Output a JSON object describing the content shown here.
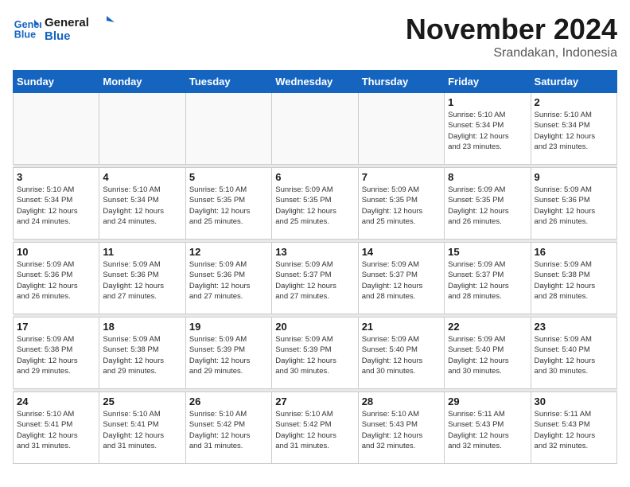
{
  "logo": {
    "line1": "General",
    "line2": "Blue"
  },
  "title": "November 2024",
  "location": "Srandakan, Indonesia",
  "weekdays": [
    "Sunday",
    "Monday",
    "Tuesday",
    "Wednesday",
    "Thursday",
    "Friday",
    "Saturday"
  ],
  "weeks": [
    [
      {
        "day": "",
        "info": ""
      },
      {
        "day": "",
        "info": ""
      },
      {
        "day": "",
        "info": ""
      },
      {
        "day": "",
        "info": ""
      },
      {
        "day": "",
        "info": ""
      },
      {
        "day": "1",
        "info": "Sunrise: 5:10 AM\nSunset: 5:34 PM\nDaylight: 12 hours\nand 23 minutes."
      },
      {
        "day": "2",
        "info": "Sunrise: 5:10 AM\nSunset: 5:34 PM\nDaylight: 12 hours\nand 23 minutes."
      }
    ],
    [
      {
        "day": "3",
        "info": "Sunrise: 5:10 AM\nSunset: 5:34 PM\nDaylight: 12 hours\nand 24 minutes."
      },
      {
        "day": "4",
        "info": "Sunrise: 5:10 AM\nSunset: 5:34 PM\nDaylight: 12 hours\nand 24 minutes."
      },
      {
        "day": "5",
        "info": "Sunrise: 5:10 AM\nSunset: 5:35 PM\nDaylight: 12 hours\nand 25 minutes."
      },
      {
        "day": "6",
        "info": "Sunrise: 5:09 AM\nSunset: 5:35 PM\nDaylight: 12 hours\nand 25 minutes."
      },
      {
        "day": "7",
        "info": "Sunrise: 5:09 AM\nSunset: 5:35 PM\nDaylight: 12 hours\nand 25 minutes."
      },
      {
        "day": "8",
        "info": "Sunrise: 5:09 AM\nSunset: 5:35 PM\nDaylight: 12 hours\nand 26 minutes."
      },
      {
        "day": "9",
        "info": "Sunrise: 5:09 AM\nSunset: 5:36 PM\nDaylight: 12 hours\nand 26 minutes."
      }
    ],
    [
      {
        "day": "10",
        "info": "Sunrise: 5:09 AM\nSunset: 5:36 PM\nDaylight: 12 hours\nand 26 minutes."
      },
      {
        "day": "11",
        "info": "Sunrise: 5:09 AM\nSunset: 5:36 PM\nDaylight: 12 hours\nand 27 minutes."
      },
      {
        "day": "12",
        "info": "Sunrise: 5:09 AM\nSunset: 5:36 PM\nDaylight: 12 hours\nand 27 minutes."
      },
      {
        "day": "13",
        "info": "Sunrise: 5:09 AM\nSunset: 5:37 PM\nDaylight: 12 hours\nand 27 minutes."
      },
      {
        "day": "14",
        "info": "Sunrise: 5:09 AM\nSunset: 5:37 PM\nDaylight: 12 hours\nand 28 minutes."
      },
      {
        "day": "15",
        "info": "Sunrise: 5:09 AM\nSunset: 5:37 PM\nDaylight: 12 hours\nand 28 minutes."
      },
      {
        "day": "16",
        "info": "Sunrise: 5:09 AM\nSunset: 5:38 PM\nDaylight: 12 hours\nand 28 minutes."
      }
    ],
    [
      {
        "day": "17",
        "info": "Sunrise: 5:09 AM\nSunset: 5:38 PM\nDaylight: 12 hours\nand 29 minutes."
      },
      {
        "day": "18",
        "info": "Sunrise: 5:09 AM\nSunset: 5:38 PM\nDaylight: 12 hours\nand 29 minutes."
      },
      {
        "day": "19",
        "info": "Sunrise: 5:09 AM\nSunset: 5:39 PM\nDaylight: 12 hours\nand 29 minutes."
      },
      {
        "day": "20",
        "info": "Sunrise: 5:09 AM\nSunset: 5:39 PM\nDaylight: 12 hours\nand 30 minutes."
      },
      {
        "day": "21",
        "info": "Sunrise: 5:09 AM\nSunset: 5:40 PM\nDaylight: 12 hours\nand 30 minutes."
      },
      {
        "day": "22",
        "info": "Sunrise: 5:09 AM\nSunset: 5:40 PM\nDaylight: 12 hours\nand 30 minutes."
      },
      {
        "day": "23",
        "info": "Sunrise: 5:09 AM\nSunset: 5:40 PM\nDaylight: 12 hours\nand 30 minutes."
      }
    ],
    [
      {
        "day": "24",
        "info": "Sunrise: 5:10 AM\nSunset: 5:41 PM\nDaylight: 12 hours\nand 31 minutes."
      },
      {
        "day": "25",
        "info": "Sunrise: 5:10 AM\nSunset: 5:41 PM\nDaylight: 12 hours\nand 31 minutes."
      },
      {
        "day": "26",
        "info": "Sunrise: 5:10 AM\nSunset: 5:42 PM\nDaylight: 12 hours\nand 31 minutes."
      },
      {
        "day": "27",
        "info": "Sunrise: 5:10 AM\nSunset: 5:42 PM\nDaylight: 12 hours\nand 31 minutes."
      },
      {
        "day": "28",
        "info": "Sunrise: 5:10 AM\nSunset: 5:43 PM\nDaylight: 12 hours\nand 32 minutes."
      },
      {
        "day": "29",
        "info": "Sunrise: 5:11 AM\nSunset: 5:43 PM\nDaylight: 12 hours\nand 32 minutes."
      },
      {
        "day": "30",
        "info": "Sunrise: 5:11 AM\nSunset: 5:43 PM\nDaylight: 12 hours\nand 32 minutes."
      }
    ]
  ]
}
